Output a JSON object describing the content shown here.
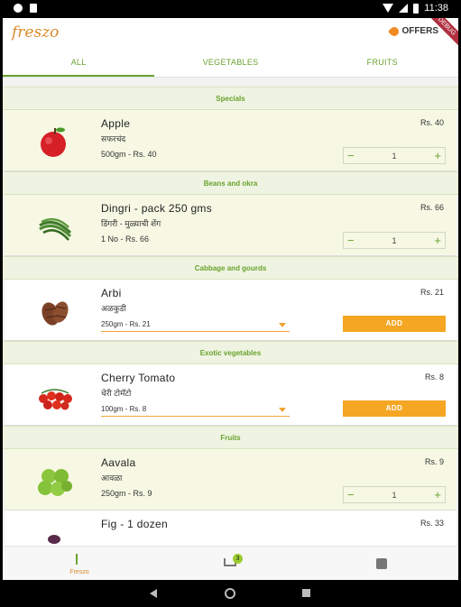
{
  "status_bar": {
    "time": "11:38"
  },
  "app": {
    "logo": "freszo",
    "offers_label": "OFFERS",
    "debug_ribbon": "DEBUG"
  },
  "tabs": [
    {
      "label": "ALL",
      "active": true
    },
    {
      "label": "VEGETABLES",
      "active": false
    },
    {
      "label": "FRUITS",
      "active": false
    }
  ],
  "sections": [
    {
      "title": "Specials",
      "product": {
        "name": "Apple",
        "local_name": "सफरचंद",
        "variant": "500gm - Rs. 40",
        "price": "Rs. 40",
        "in_cart": true,
        "qty": "1",
        "image": "apple-image"
      }
    },
    {
      "title": "Beans and okra",
      "product": {
        "name": "Dingri - pack 250 gms",
        "local_name": "डिंगरी - मुळ्याची शेंग",
        "variant": "1 No - Rs. 66",
        "price": "Rs. 66",
        "in_cart": true,
        "qty": "1",
        "image": "dingri-image"
      }
    },
    {
      "title": "Cabbage and gourds",
      "product": {
        "name": "Arbi",
        "local_name": "अळकुडी",
        "variant": "250gm - Rs. 21",
        "price": "Rs. 21",
        "in_cart": false,
        "add_label": "ADD",
        "image": "arbi-image"
      }
    },
    {
      "title": "Exotic vegetables",
      "product": {
        "name": "Cherry Tomato",
        "local_name": "चेरी टोमॅटो",
        "variant": "100gm - Rs. 8",
        "price": "Rs. 8",
        "in_cart": false,
        "add_label": "ADD",
        "image": "cherry-tomato-image"
      }
    },
    {
      "title": "Fruits",
      "product": {
        "name": "Aavala",
        "local_name": "आवळा",
        "variant": "250gm - Rs. 9",
        "price": "Rs. 9",
        "in_cart": true,
        "qty": "1",
        "image": "aavala-image"
      }
    }
  ],
  "partial_item": {
    "name": "Fig - 1 dozen",
    "price": "Rs. 33"
  },
  "bottom_nav": {
    "home_label": "Freszo",
    "cart_count": "3"
  },
  "stepper": {
    "minus": "−",
    "plus": "+"
  }
}
